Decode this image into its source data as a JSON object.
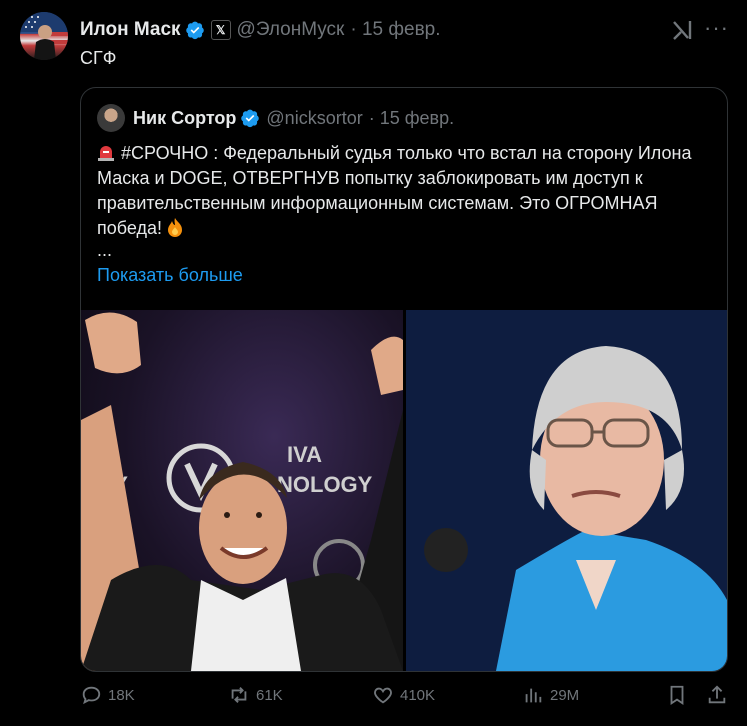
{
  "tweet": {
    "author_name": "Илон Маск",
    "author_handle": "@ЭлонМуск",
    "date": "· 15 февр.",
    "text": "СГФ",
    "x_badge": "𝕏"
  },
  "quote": {
    "author_name": "Ник Сортор",
    "author_handle": "@nicksortor",
    "date": "· 15 февр.",
    "text": "#СРОЧНО : Федеральный судья только что встал на сторону Илона Маска и DOGE, ОТВЕРГНУВ попытку заблокировать им доступ к правительственным информационным системам. Это ОГРОМНАЯ победа!",
    "ellipsis": "...",
    "show_more": "Показать больше",
    "images": [
      "Elon Musk raising fists in celebration",
      "Elizabeth Warren in blue jacket"
    ]
  },
  "actions": {
    "replies": "18K",
    "reposts": "61K",
    "likes": "410K",
    "views": "29M"
  },
  "colors": {
    "accent": "#1d9bf0",
    "muted": "#71767b",
    "text": "#e7e9ea",
    "bg": "#000000",
    "border": "#2f3336"
  },
  "icons": [
    "verified-icon",
    "grok-icon",
    "more-icon",
    "reply-icon",
    "repost-icon",
    "like-icon",
    "views-icon",
    "bookmark-icon",
    "share-icon"
  ]
}
